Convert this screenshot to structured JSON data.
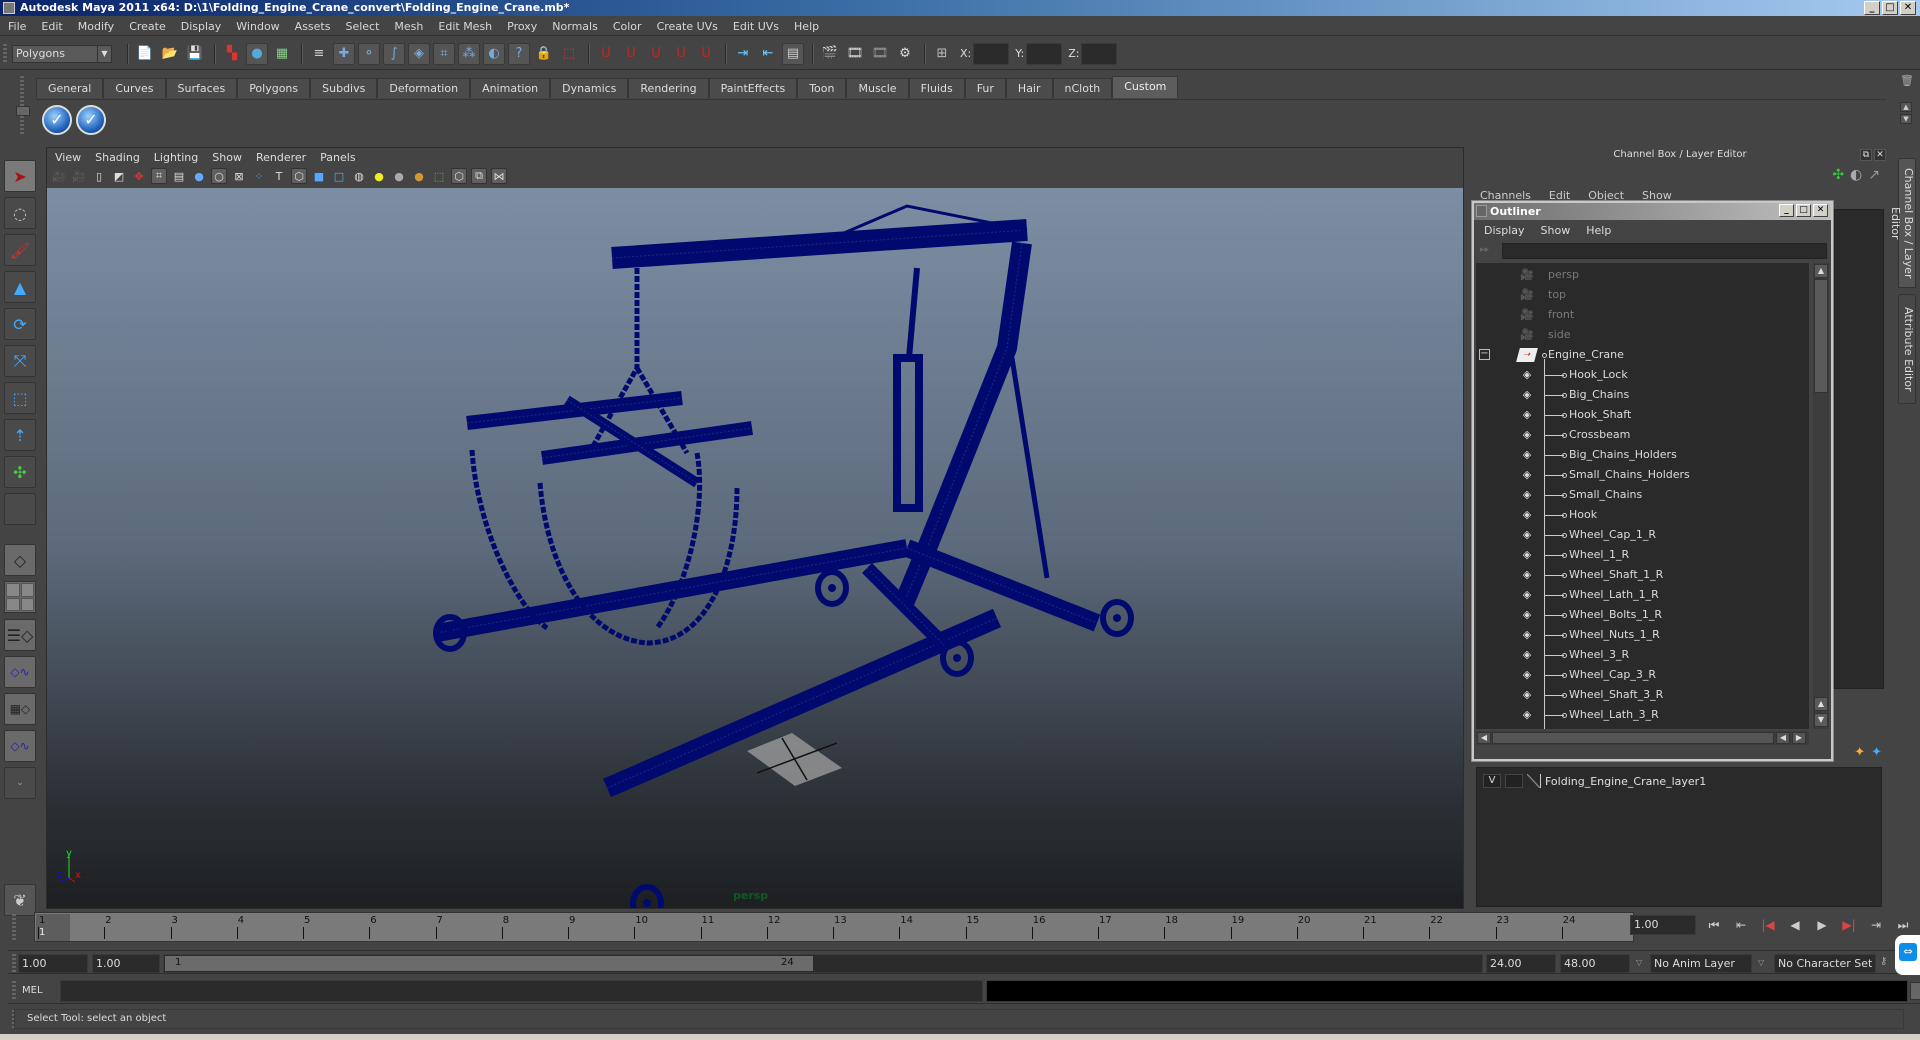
{
  "window": {
    "title": "Autodesk Maya 2011 x64: D:\\1\\Folding_Engine_Crane_convert\\Folding_Engine_Crane.mb*",
    "controls": {
      "minimize": "_",
      "maximize": "□",
      "close": "✕"
    }
  },
  "menubar": [
    "File",
    "Edit",
    "Modify",
    "Create",
    "Display",
    "Window",
    "Assets",
    "Select",
    "Mesh",
    "Edit Mesh",
    "Proxy",
    "Normals",
    "Color",
    "Create UVs",
    "Edit UVs",
    "Help"
  ],
  "statusline": {
    "mode": "Polygons",
    "xyz_labels": {
      "x": "X:",
      "y": "Y:",
      "z": "Z:"
    },
    "xyz_values": {
      "x": "",
      "y": "",
      "z": ""
    }
  },
  "shelf": {
    "tabs": [
      "General",
      "Curves",
      "Surfaces",
      "Polygons",
      "Subdivs",
      "Deformation",
      "Animation",
      "Dynamics",
      "Rendering",
      "PaintEffects",
      "Toon",
      "Muscle",
      "Fluids",
      "Fur",
      "Hair",
      "nCloth",
      "Custom"
    ],
    "active_tab": "Custom",
    "buttons": [
      "check-icon",
      "check-icon"
    ]
  },
  "toolbox": {
    "tools": [
      "select-tool",
      "lasso-tool",
      "paint-select-tool",
      "move-tool",
      "rotate-tool",
      "scale-tool",
      "universal-manipulator",
      "soft-modification-tool",
      "show-manipulator-tool",
      "last-used-tool"
    ],
    "active_tool": "select-tool"
  },
  "viewport": {
    "menu": [
      "View",
      "Shading",
      "Lighting",
      "Show",
      "Renderer",
      "Panels"
    ],
    "camera": "persp",
    "axis_labels": {
      "x": "x",
      "y": "y",
      "z": "z"
    },
    "colors": {
      "wireframe": "#000a6e",
      "axis_x": "#e01010",
      "axis_y": "#20e020",
      "axis_z": "#1010e0"
    }
  },
  "channel_box": {
    "title": "Channel Box / Layer Editor",
    "menu": [
      "Channels",
      "Edit",
      "Object",
      "Show"
    ],
    "side_tabs": [
      "Channel Box / Layer Editor",
      "Attribute Editor"
    ],
    "layers": [
      {
        "visible": "V",
        "name": "Folding_Engine_Crane_layer1"
      }
    ]
  },
  "outliner": {
    "title": "Outliner",
    "menu": [
      "Display",
      "Show",
      "Help"
    ],
    "filter_value": "",
    "cameras": [
      "persp",
      "top",
      "front",
      "side"
    ],
    "root": {
      "name": "Engine_Crane",
      "expanded": true,
      "expander": "−"
    },
    "children": [
      "Hook_Lock",
      "Big_Chains",
      "Hook_Shaft",
      "Crossbeam",
      "Big_Chains_Holders",
      "Small_Chains_Holders",
      "Small_Chains",
      "Hook",
      "Wheel_Cap_1_R",
      "Wheel_1_R",
      "Wheel_Shaft_1_R",
      "Wheel_Lath_1_R",
      "Wheel_Bolts_1_R",
      "Wheel_Nuts_1_R",
      "Wheel_3_R",
      "Wheel_Cap_3_R",
      "Wheel_Shaft_3_R",
      "Wheel_Lath_3_R"
    ]
  },
  "timeline": {
    "ticks": [
      "1",
      "2",
      "3",
      "4",
      "5",
      "6",
      "7",
      "8",
      "9",
      "10",
      "11",
      "12",
      "13",
      "14",
      "15",
      "16",
      "17",
      "18",
      "19",
      "20",
      "21",
      "22",
      "23",
      "24"
    ],
    "current_frame_label": "1",
    "current_time": "1.00",
    "playback_buttons": [
      "go-to-start",
      "step-back-frame",
      "step-back-key",
      "play-backwards",
      "play-forwards",
      "step-forward-key",
      "step-forward-frame",
      "go-to-end"
    ]
  },
  "range": {
    "start_time": "1.00",
    "playback_start": "1.00",
    "slider_start": "1",
    "slider_end": "24",
    "playback_end": "24.00",
    "end_time": "48.00",
    "anim_layer": "No Anim Layer",
    "character_set": "No Character Set"
  },
  "command_line": {
    "label": "MEL",
    "value": "",
    "output": ""
  },
  "help_line": "Select Tool: select an object"
}
